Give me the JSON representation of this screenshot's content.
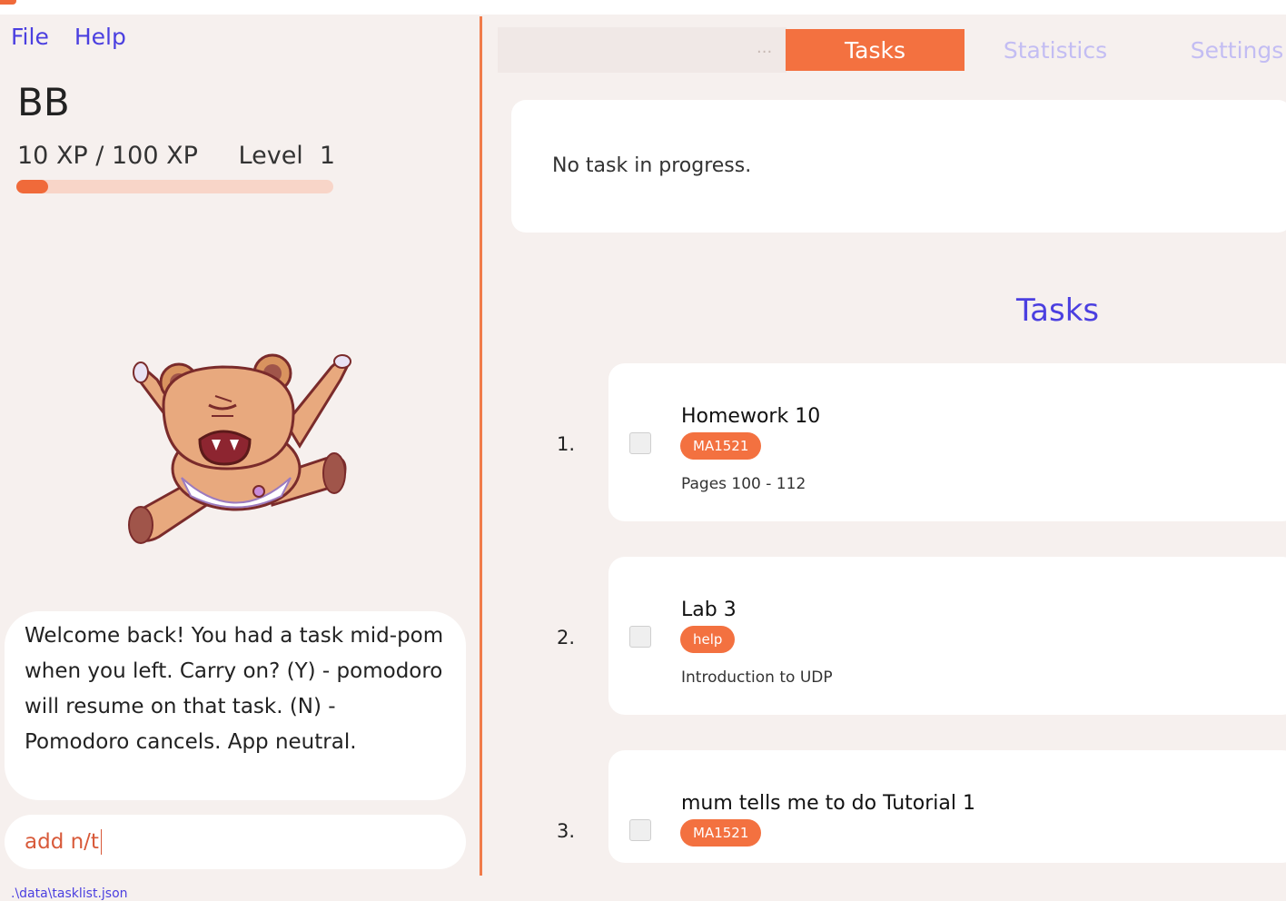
{
  "menu": {
    "file": "File",
    "help": "Help"
  },
  "user": {
    "name": "BB",
    "xp_text": "10 XP / 100 XP",
    "level_label": "Level",
    "level_value": "1",
    "xp_progress": 0.1
  },
  "chat": {
    "message": "Welcome back! You had a task mid-pom when you left. Carry on? (Y) - pomodoro will resume on that task. (N) - Pomodoro cancels. App neutral."
  },
  "command": {
    "value": "add n/t"
  },
  "status_bar": {
    "path": ".\\data\\tasklist.json"
  },
  "tabs": {
    "more": "...",
    "items": [
      {
        "label": "Tasks",
        "active": true
      },
      {
        "label": "Statistics",
        "active": false
      },
      {
        "label": "Settings",
        "active": false
      }
    ]
  },
  "progress": {
    "text": "No task in progress."
  },
  "task_section": {
    "title": "Tasks"
  },
  "tasks": [
    {
      "number": "1.",
      "name": "Homework 10",
      "tag": "MA1521",
      "description": "Pages 100 - 112"
    },
    {
      "number": "2.",
      "name": "Lab 3",
      "tag": "help",
      "description": "Introduction to UDP"
    },
    {
      "number": "3.",
      "name": "mum tells me to do Tutorial 1",
      "tag": "MA1521",
      "description": ""
    }
  ],
  "colors": {
    "accent": "#f37140",
    "link": "#4b3fe0",
    "background": "#f6f0ee",
    "xp_track": "#f8d5c8"
  },
  "icons": {
    "mascot": "angry-bear-mascot-icon"
  }
}
